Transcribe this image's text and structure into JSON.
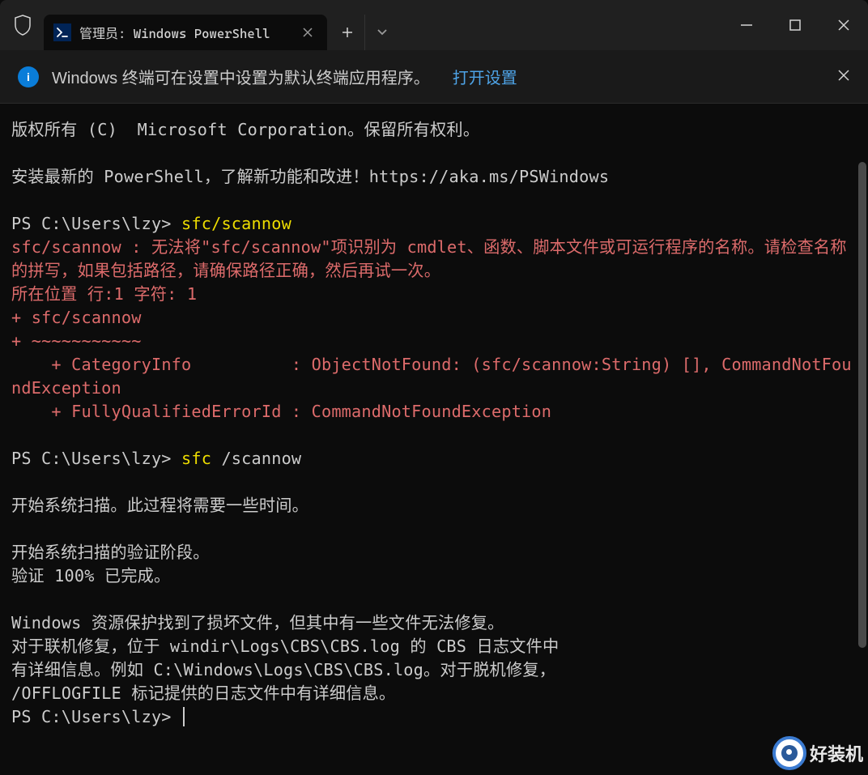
{
  "tab": {
    "title": "管理员: Windows PowerShell",
    "icon_label": ">_"
  },
  "info_bar": {
    "message": "Windows 终端可在设置中设置为默认终端应用程序。",
    "link": "打开设置"
  },
  "terminal": {
    "line_copyright": "版权所有 (C)  Microsoft Corporation。保留所有权利。",
    "line_install": "安装最新的 PowerShell，了解新功能和改进！https://aka.ms/PSWindows",
    "prompt1_prefix": "PS C:\\Users\\lzy> ",
    "prompt1_cmd": "sfc/scannow",
    "error1": "sfc/scannow : 无法将\"sfc/scannow\"项识别为 cmdlet、函数、脚本文件或可运行程序的名称。请检查名称的拼写，如果包括路径，请确保路径正确，然后再试一次。",
    "error2": "所在位置 行:1 字符: 1",
    "error3": "+ sfc/scannow",
    "error4": "+ ~~~~~~~~~~~",
    "error5": "    + CategoryInfo          : ObjectNotFound: (sfc/scannow:String) [], CommandNotFoundException",
    "error6": "    + FullyQualifiedErrorId : CommandNotFoundException",
    "prompt2_prefix": "PS C:\\Users\\lzy> ",
    "prompt2_cmd": "sfc ",
    "prompt2_arg": "/scannow",
    "scan1": "开始系统扫描。此过程将需要一些时间。",
    "scan2": "开始系统扫描的验证阶段。",
    "scan3": "验证 100% 已完成。",
    "result1": "Windows 资源保护找到了损坏文件，但其中有一些文件无法修复。",
    "result2": "对于联机修复，位于 windir\\Logs\\CBS\\CBS.log 的 CBS 日志文件中",
    "result3": "有详细信息。例如 C:\\Windows\\Logs\\CBS\\CBS.log。对于脱机修复，",
    "result4": "/OFFLOGFILE 标记提供的日志文件中有详细信息。",
    "prompt3": "PS C:\\Users\\lzy> "
  },
  "watermark": {
    "text": "好装机"
  }
}
